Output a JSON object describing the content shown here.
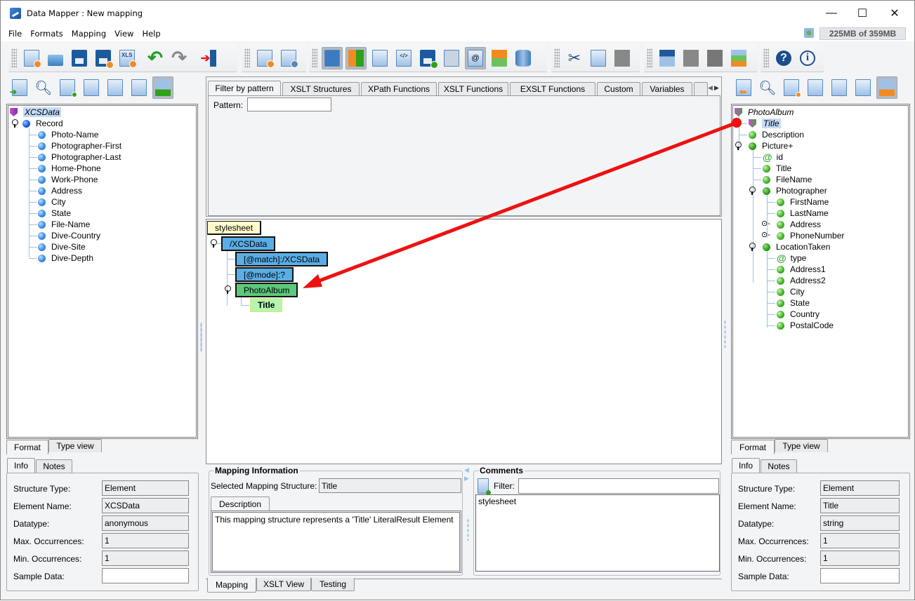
{
  "window": {
    "title": "Data Mapper : New mapping",
    "minimize": "—",
    "maximize": "☐",
    "close": "✕"
  },
  "menu": [
    "File",
    "Formats",
    "Mapping",
    "View",
    "Help"
  ],
  "memory": "225MB of 359MB",
  "toolbar": {
    "groups": [
      [
        "new-mapping-icon",
        "open-icon",
        "save-icon",
        "save-as-icon",
        "export-xls-icon",
        "undo-icon",
        "redo-icon",
        "exit-icon"
      ],
      [
        "add-mapping-icon",
        "mapping-settings-icon"
      ],
      [
        "view-info-icon",
        "view-colors-icon",
        "validate-icon",
        "xslt-icon",
        "save-schedule-icon",
        "xml-icon",
        "namespace-icon",
        "rename-icon",
        "database-icon"
      ],
      [
        "cut-icon",
        "copy-icon",
        "paste-icon"
      ],
      [
        "move-up-icon",
        "expand-icon",
        "collapse-icon",
        "structure-icon"
      ],
      [
        "help-icon",
        "about-icon"
      ]
    ]
  },
  "source": {
    "root": "XCSData",
    "record": "Record",
    "fields": [
      "Photo-Name",
      "Photographer-First",
      "Photographer-Last",
      "Home-Phone",
      "Work-Phone",
      "Address",
      "City",
      "State",
      "File-Name",
      "Dive-Country",
      "Dive-Site",
      "Dive-Depth"
    ],
    "view_tabs": [
      "Format",
      "Type view"
    ],
    "info_tabs": [
      "Info",
      "Notes"
    ],
    "info": [
      {
        "label": "Structure Type:",
        "value": "Element"
      },
      {
        "label": "Element Name:",
        "value": "XCSData"
      },
      {
        "label": "Datatype:",
        "value": "anonymous"
      },
      {
        "label": "Max. Occurrences:",
        "value": "1"
      },
      {
        "label": "Min. Occurrences:",
        "value": "1"
      },
      {
        "label": "Sample Data:",
        "value": ""
      }
    ]
  },
  "target": {
    "root": "PhotoAlbum",
    "nodes": [
      {
        "label": "Title",
        "level": 1,
        "type": "shield",
        "selected": true
      },
      {
        "label": "Description",
        "level": 1,
        "type": "green"
      },
      {
        "label": "Picture+",
        "level": 1,
        "type": "dgreen",
        "expanded": true
      },
      {
        "label": "id",
        "level": 2,
        "type": "attr"
      },
      {
        "label": "Title",
        "level": 2,
        "type": "green"
      },
      {
        "label": "FileName",
        "level": 2,
        "type": "green"
      },
      {
        "label": "Photographer",
        "level": 2,
        "type": "dgreen",
        "expanded": true
      },
      {
        "label": "FirstName",
        "level": 3,
        "type": "green"
      },
      {
        "label": "LastName",
        "level": 3,
        "type": "green"
      },
      {
        "label": "Address",
        "level": 3,
        "type": "green",
        "collapsed": true
      },
      {
        "label": "PhoneNumber",
        "level": 3,
        "type": "green",
        "collapsed": true
      },
      {
        "label": "LocationTaken",
        "level": 2,
        "type": "dgreen",
        "expanded": true
      },
      {
        "label": "type",
        "level": 3,
        "type": "attr"
      },
      {
        "label": "Address1",
        "level": 3,
        "type": "green"
      },
      {
        "label": "Address2",
        "level": 3,
        "type": "green"
      },
      {
        "label": "City",
        "level": 3,
        "type": "green"
      },
      {
        "label": "State",
        "level": 3,
        "type": "green"
      },
      {
        "label": "Country",
        "level": 3,
        "type": "green"
      },
      {
        "label": "PostalCode",
        "level": 3,
        "type": "green"
      }
    ],
    "view_tabs": [
      "Format",
      "Type view"
    ],
    "info_tabs": [
      "Info",
      "Notes"
    ],
    "info": [
      {
        "label": "Structure Type:",
        "value": "Element"
      },
      {
        "label": "Element Name:",
        "value": "Title"
      },
      {
        "label": "Datatype:",
        "value": "string"
      },
      {
        "label": "Max. Occurrences:",
        "value": "1"
      },
      {
        "label": "Min. Occurrences:",
        "value": "1"
      },
      {
        "label": "Sample Data:",
        "value": ""
      }
    ]
  },
  "center": {
    "tabs": [
      "Filter by pattern",
      "XSLT Structures",
      "XPath Functions",
      "XSLT Functions",
      "EXSLT Functions",
      "Custom",
      "Variables"
    ],
    "pattern_label": "Pattern:",
    "pattern_value": "",
    "mapping_tree": {
      "stylesheet": "stylesheet",
      "template": "/XCSData",
      "match": "[@match]:/XCSData",
      "mode": "[@mode]:?",
      "element": "PhotoAlbum",
      "child": "Title"
    },
    "mapping_info": {
      "title": "Mapping Information",
      "selected_label": "Selected Mapping Structure:",
      "selected_value": "Title",
      "desc_tab": "Description",
      "description": "This mapping structure represents a 'Title' LiteralResult Element"
    },
    "comments": {
      "title": "Comments",
      "filter_label": "Filter:",
      "filter_value": "",
      "items": [
        "stylesheet"
      ]
    },
    "bottom_tabs": [
      "Mapping",
      "XSLT View",
      "Testing"
    ]
  },
  "colors": {
    "arrow": "#ee1111",
    "template_box": "#5aaee6",
    "element_box": "#5cc87a",
    "literal_box": "#b4f5b4",
    "stylesheet_box": "#fffccc"
  }
}
